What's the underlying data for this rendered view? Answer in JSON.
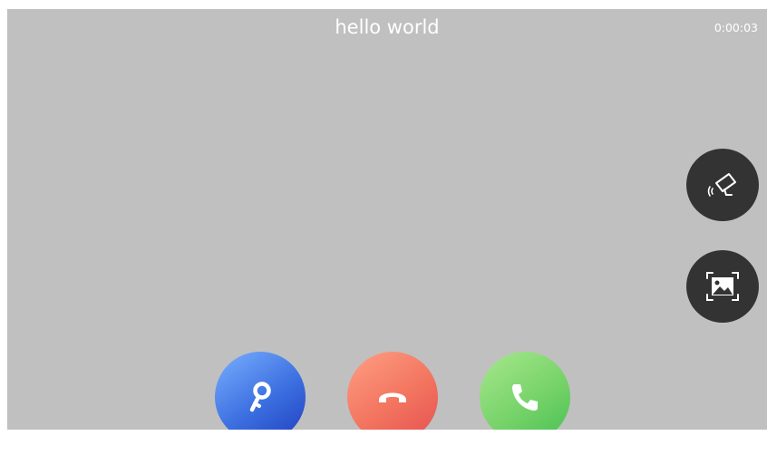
{
  "header": {
    "title": "hello world",
    "timer": "0:00:03"
  },
  "side_buttons": [
    {
      "name": "surveillance-camera",
      "icon": "cctv-camera-icon"
    },
    {
      "name": "snapshot",
      "icon": "picture-capture-icon"
    }
  ],
  "call_controls": [
    {
      "name": "unlock",
      "icon": "key-icon",
      "color": "#3c6fe0"
    },
    {
      "name": "hang-up",
      "icon": "hangup-phone-icon",
      "color": "#f2745f"
    },
    {
      "name": "answer",
      "icon": "phone-icon",
      "color": "#5ec85a"
    }
  ],
  "colors": {
    "screen_background": "#c0c0c0",
    "side_button_background": "#333333",
    "text": "#ffffff"
  }
}
